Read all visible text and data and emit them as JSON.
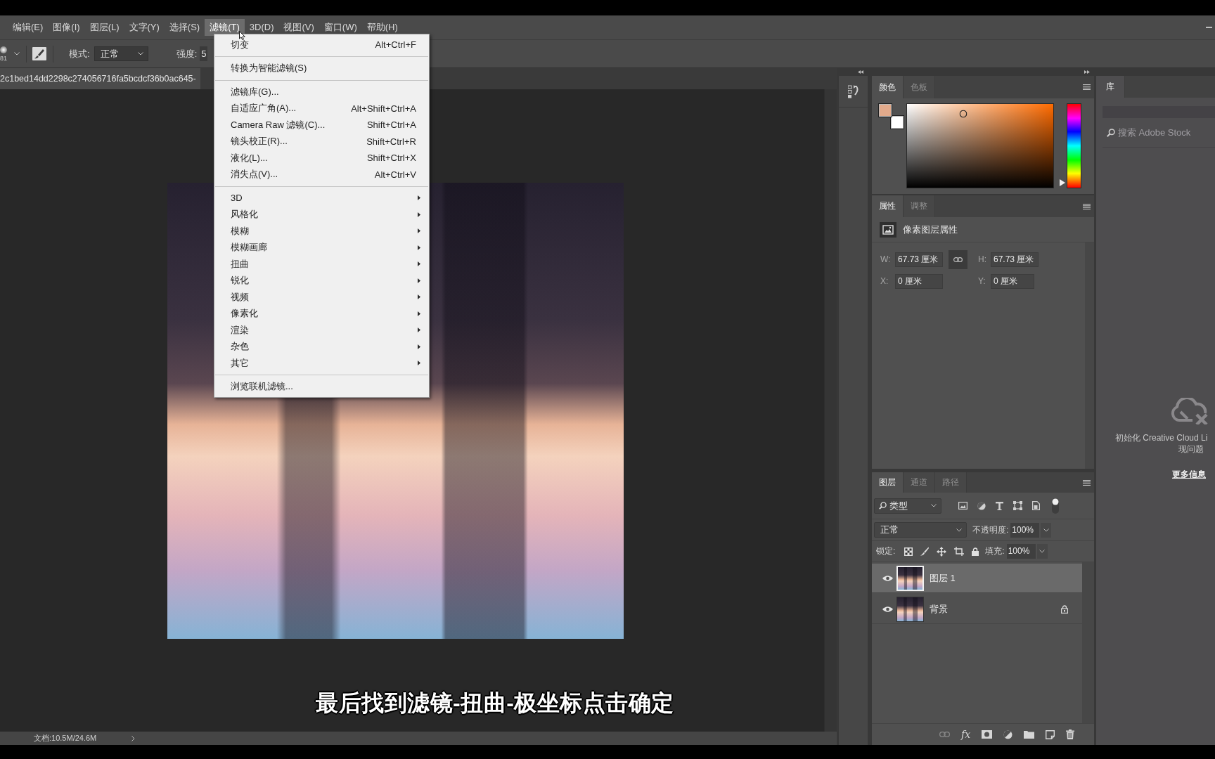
{
  "menu_bar": {
    "items": [
      {
        "label": "编辑(E)",
        "selected": false
      },
      {
        "label": "图像(I)",
        "selected": false
      },
      {
        "label": "图层(L)",
        "selected": false
      },
      {
        "label": "文字(Y)",
        "selected": false
      },
      {
        "label": "选择(S)",
        "selected": false
      },
      {
        "label": "滤镜(T)",
        "selected": true
      },
      {
        "label": "3D(D)",
        "selected": false
      },
      {
        "label": "视图(V)",
        "selected": false
      },
      {
        "label": "窗口(W)",
        "selected": false
      },
      {
        "label": "帮助(H)",
        "selected": false
      }
    ]
  },
  "options_bar": {
    "brush_size": "81",
    "mode": {
      "label": "模式:",
      "value": "正常"
    },
    "strength": {
      "label": "强度:",
      "value": "5"
    }
  },
  "document_tab": {
    "title": "2c1bed14dd2298c274056716fa5bcdcf36b0ac645-"
  },
  "filter_menu": {
    "sections": [
      {
        "items": [
          {
            "label": "切变",
            "shortcut": "Alt+Ctrl+F",
            "kind": "command"
          }
        ]
      },
      {
        "items": [
          {
            "label": "转换为智能滤镜(S)",
            "kind": "command"
          }
        ]
      },
      {
        "items": [
          {
            "label": "滤镜库(G)...",
            "kind": "command"
          },
          {
            "label": "自适应广角(A)...",
            "shortcut": "Alt+Shift+Ctrl+A",
            "kind": "command"
          },
          {
            "label": "Camera Raw 滤镜(C)...",
            "shortcut": "Shift+Ctrl+A",
            "kind": "command"
          },
          {
            "label": "镜头校正(R)...",
            "shortcut": "Shift+Ctrl+R",
            "kind": "command"
          },
          {
            "label": "液化(L)...",
            "shortcut": "Shift+Ctrl+X",
            "kind": "command"
          },
          {
            "label": "消失点(V)...",
            "shortcut": "Alt+Ctrl+V",
            "kind": "command"
          }
        ]
      },
      {
        "items": [
          {
            "label": "3D",
            "kind": "submenu"
          },
          {
            "label": "风格化",
            "kind": "submenu"
          },
          {
            "label": "模糊",
            "kind": "submenu"
          },
          {
            "label": "模糊画廊",
            "kind": "submenu"
          },
          {
            "label": "扭曲",
            "kind": "submenu"
          },
          {
            "label": "锐化",
            "kind": "submenu"
          },
          {
            "label": "视频",
            "kind": "submenu"
          },
          {
            "label": "像素化",
            "kind": "submenu"
          },
          {
            "label": "渲染",
            "kind": "submenu"
          },
          {
            "label": "杂色",
            "kind": "submenu"
          },
          {
            "label": "其它",
            "kind": "submenu"
          }
        ]
      },
      {
        "items": [
          {
            "label": "浏览联机滤镜...",
            "kind": "command"
          }
        ]
      }
    ]
  },
  "canvas": {
    "caption": "最后找到滤镜-扭曲-极坐标点击确定"
  },
  "status_bar": {
    "document_size": "文档:10.5M/24.6M"
  },
  "color_panel": {
    "tabs": [
      {
        "label": "颜色",
        "selected": true
      },
      {
        "label": "色板",
        "selected": false
      }
    ],
    "swatches": [
      {
        "kind": "foreground",
        "color": "#e2aa8b"
      },
      {
        "kind": "background",
        "color": "#ffffff"
      }
    ],
    "hue_slider": {
      "level": 0.07
    }
  },
  "properties_panel": {
    "tabs": [
      {
        "label": "属性",
        "selected": true
      },
      {
        "label": "调整",
        "selected": false
      }
    ],
    "header": "像素图层属性",
    "fields": [
      {
        "label": "W:",
        "value": "67.73 厘米"
      },
      {
        "label": "H:",
        "value": "67.73 厘米"
      },
      {
        "label": "X:",
        "value": "0 厘米"
      },
      {
        "label": "Y:",
        "value": "0 厘米"
      }
    ]
  },
  "layers_panel": {
    "tabs": [
      {
        "label": "图层",
        "selected": true
      },
      {
        "label": "通道",
        "selected": false
      },
      {
        "label": "路径",
        "selected": false
      }
    ],
    "filter_kind": "类型",
    "blend_mode": "正常",
    "opacity": {
      "label": "不透明度:",
      "value": "100%"
    },
    "lock_label": "锁定:",
    "fill": {
      "label": "填充:",
      "value": "100%"
    },
    "layers": [
      {
        "name": "图层 1",
        "visible": true,
        "selected": true,
        "locked": false
      },
      {
        "name": "背景",
        "visible": true,
        "selected": false,
        "locked": true
      }
    ],
    "effects_label": "fx"
  },
  "library_panel": {
    "tabs": [
      {
        "label": "库",
        "selected": true
      }
    ],
    "search": {
      "placeholder": "搜索 Adobe Stock"
    },
    "message_lines": [
      "初始化 Creative Cloud Li",
      "现问题"
    ],
    "link": "更多信息"
  }
}
